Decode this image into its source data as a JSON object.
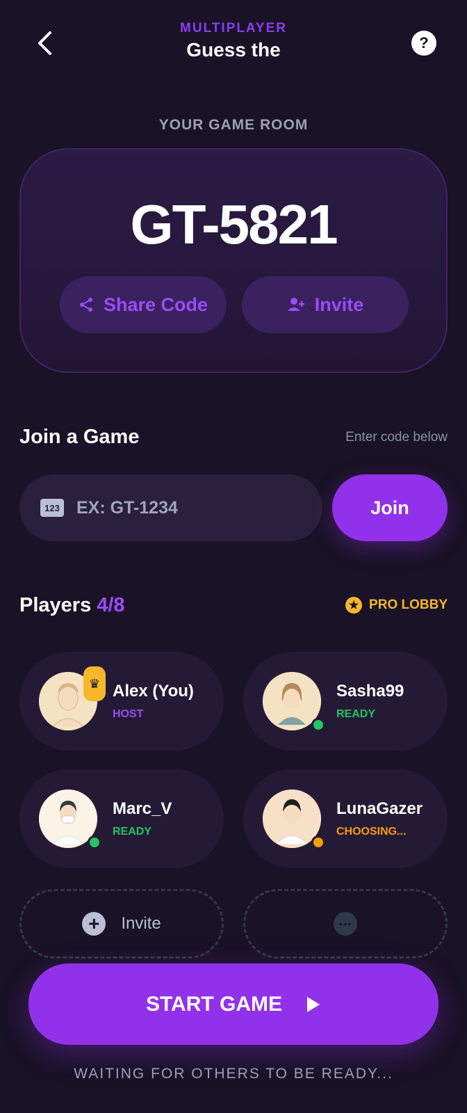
{
  "header": {
    "subtitle": "MULTIPLAYER",
    "title": "Guess the",
    "help_label": "?"
  },
  "room": {
    "label": "YOUR GAME ROOM",
    "code": "GT-5821",
    "share_label": "Share Code",
    "invite_label": "Invite"
  },
  "join": {
    "title": "Join a Game",
    "hint": "Enter code below",
    "icon_text": "123",
    "placeholder": "EX: GT-1234",
    "button_label": "Join"
  },
  "players": {
    "title": "Players",
    "count": "4/8",
    "badge": "PRO LOBBY",
    "list": [
      {
        "name": "Alex (You)",
        "status": "HOST",
        "status_color": "#9b4cf5"
      },
      {
        "name": "Sasha99",
        "status": "READY",
        "status_color": "#22c55e"
      },
      {
        "name": "Marc_V",
        "status": "READY",
        "status_color": "#22c55e"
      },
      {
        "name": "LunaGazer",
        "status": "CHOOSING...",
        "status_color": "#f59e0b"
      }
    ],
    "invite_slot_label": "Invite"
  },
  "footer": {
    "start_label": "START GAME",
    "waiting_text": "WAITING FOR OTHERS TO BE READY..."
  },
  "colors": {
    "accent": "#9231ea",
    "background": "#1a1226",
    "gold": "#f4b82a"
  }
}
